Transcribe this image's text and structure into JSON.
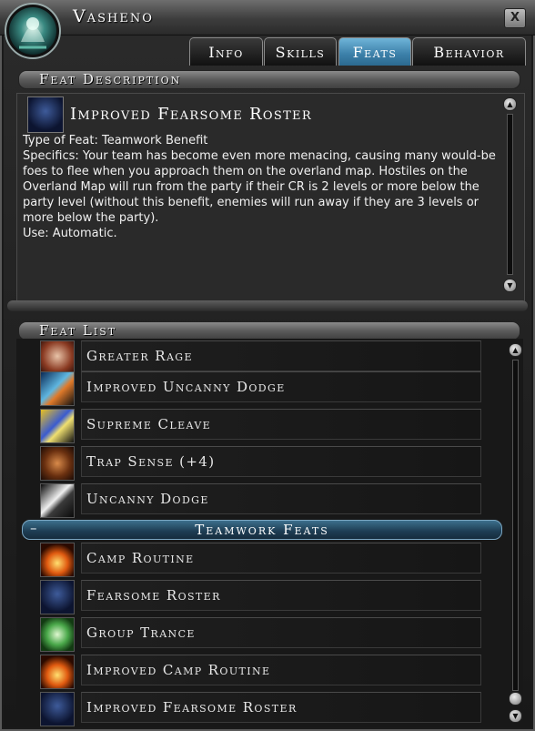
{
  "window": {
    "title": "Vasheno",
    "close_label": "X"
  },
  "tabs": [
    {
      "label": "Info"
    },
    {
      "label": "Skills"
    },
    {
      "label": "Feats"
    },
    {
      "label": "Behavior"
    }
  ],
  "active_tab": "Feats",
  "description": {
    "section_title": "Feat Description",
    "feat_name": "Improved Fearsome Roster",
    "lines": [
      "Type of Feat: Teamwork Benefit",
      "Specifics: Your team has become even more menacing, causing many would-be foes to flee when you approach them on the overland map. Hostiles on the Overland Map will run from the party if their CR is 2 levels or more below the party level (without this benefit, enemies will run away if they are 3 levels or more below the party).",
      "Use: Automatic."
    ]
  },
  "feat_list": {
    "section_title": "Feat List",
    "items": [
      {
        "label": "Greater Rage",
        "icon": "rage-face-icon"
      },
      {
        "label": "Improved Uncanny Dodge",
        "icon": "dodge-blade-icon"
      },
      {
        "label": "Supreme Cleave",
        "icon": "cleave-axe-icon"
      },
      {
        "label": "Trap Sense (+4)",
        "icon": "rope-trap-icon"
      },
      {
        "label": "Uncanny Dodge",
        "icon": "dodge-icon"
      }
    ],
    "group": {
      "toggle": "–",
      "title": "Teamwork Feats",
      "items": [
        {
          "label": "Camp Routine",
          "icon": "campfire-icon"
        },
        {
          "label": "Fearsome Roster",
          "icon": "shadow-face-icon"
        },
        {
          "label": "Group Trance",
          "icon": "trance-rune-icon"
        },
        {
          "label": "Improved Camp Routine",
          "icon": "campfire-icon"
        },
        {
          "label": "Improved Fearsome Roster",
          "icon": "shadow-face-icon"
        }
      ]
    }
  },
  "colors": {
    "active_tab": "#3b7fa8",
    "group_header": "#1d3c52"
  }
}
